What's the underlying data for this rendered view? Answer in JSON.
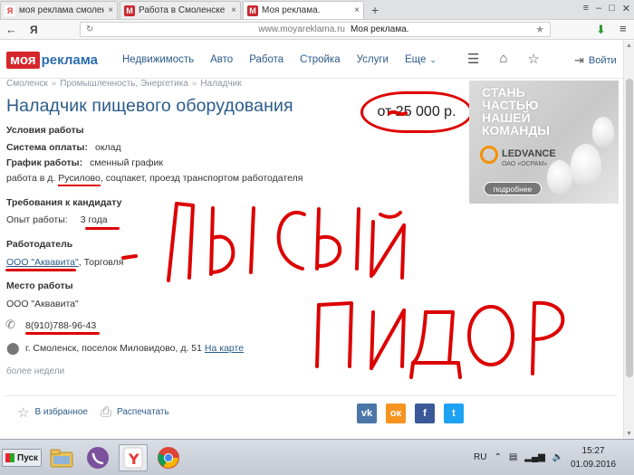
{
  "browser": {
    "tabs": [
      {
        "label": "моя реклама смоленск рабо",
        "active": false
      },
      {
        "label": "Работа в Смоленске – нала",
        "active": false
      },
      {
        "label": "Моя реклама.",
        "active": true
      }
    ],
    "new_tab": "+",
    "url_domain": "www.moyareklama.ru",
    "page_title": "Моя реклама."
  },
  "site": {
    "logo_moya": "моя",
    "logo_rest": "реклама",
    "nav": [
      "Недвижимость",
      "Авто",
      "Работа",
      "Стройка",
      "Услуги",
      "Еще"
    ],
    "login": "Войти"
  },
  "breadcrumbs": [
    "Смоленск",
    "Промышленность, Энергетика",
    "Наладчик"
  ],
  "job": {
    "title": "Наладчик пищевого оборудования",
    "salary": "от 25 000 р.",
    "conditions_heading": "Условия работы",
    "payment_label": "Система оплаты:",
    "payment_value": "оклад",
    "schedule_label": "График работы:",
    "schedule_value": "сменный график",
    "extra_prefix": "работа в д. ",
    "extra_place": "Русилово",
    "extra_rest": ", соцпакет, проезд транспортом работодателя",
    "requirements_heading": "Требования к кандидату",
    "experience_label": "Опыт работы:",
    "experience_value": "3 года",
    "employer_heading": "Работодатель",
    "employer_name": "ООО \"Аквавита\"",
    "employer_industry": ", Торговля",
    "place_heading": "Место работы",
    "place_name": "ООО \"Аквавита\"",
    "phone": "8(910)788-96-43",
    "address": "г. Смоленск, поселок Миловидово, д. 51",
    "map_link": "На карте",
    "posted": "более недели"
  },
  "ad": {
    "slogan": [
      "СТАНЬ",
      "ЧАСТЬЮ",
      "НАШЕЙ",
      "КОМАНДЫ"
    ],
    "brand": "LEDVANCE",
    "sub": "ОАО «ОСРАМ»",
    "button": "подробнее"
  },
  "footer": {
    "favorites": "В избранное",
    "print": "Распечатать",
    "social": [
      {
        "name": "vk",
        "label": "vk",
        "color": "#4a76a8"
      },
      {
        "name": "ok",
        "label": "ок",
        "color": "#f7931e"
      },
      {
        "name": "facebook",
        "label": "f",
        "color": "#3b5998"
      },
      {
        "name": "twitter",
        "label": "t",
        "color": "#1da1f2"
      }
    ]
  },
  "taskbar": {
    "start": "Пуск",
    "lang": "RU",
    "time": "15:27",
    "date": "01.09.2016"
  },
  "annotation_color": "#dd0000"
}
